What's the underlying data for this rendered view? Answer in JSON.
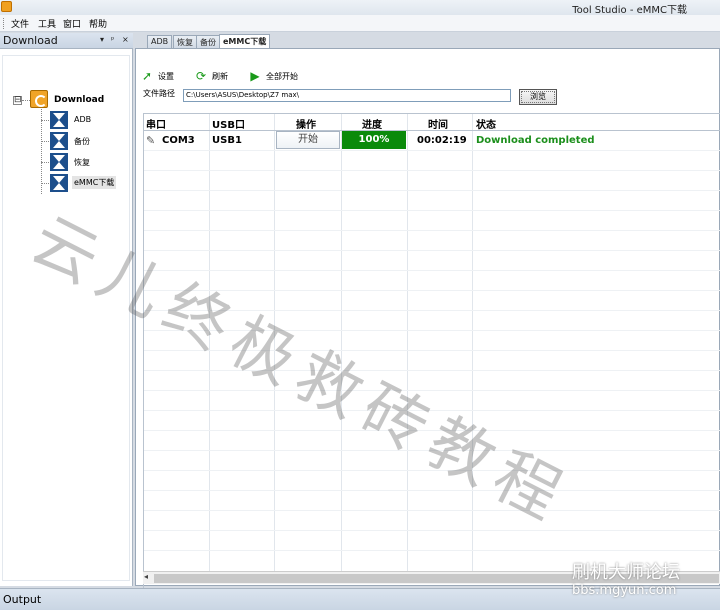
{
  "window": {
    "title": "Tool Studio - eMMC下载"
  },
  "menu": [
    "文件",
    "工具",
    "窗口",
    "帮助"
  ],
  "left_panel": {
    "title": "Download",
    "buttons": [
      "▾",
      "ᵖ",
      "×"
    ],
    "tree": {
      "root": "Download",
      "toggle": "⊟",
      "children": [
        "ADB",
        "备份",
        "恢复",
        "eMMC下载"
      ],
      "selected": "eMMC下载"
    }
  },
  "tabs": [
    "ADB",
    "恢复",
    "备份",
    "eMMC下载"
  ],
  "active_tab": "eMMC下载",
  "toolbar": [
    {
      "label": "设置",
      "icon": "arrow-right-icon"
    },
    {
      "label": "刷新",
      "icon": "refresh-icon"
    },
    {
      "label": "全部开始",
      "icon": "play-icon"
    }
  ],
  "path": {
    "label": "文件路径",
    "value": "C:\\Users\\ASUS\\Desktop\\Z7 max\\",
    "browse": "浏览"
  },
  "grid": {
    "headers": [
      "串口",
      "USB口",
      "操作",
      "进度",
      "时间",
      "状态"
    ],
    "rows": [
      {
        "port": "COM3",
        "usb": "USB1",
        "action": "开始",
        "progress_text": "100%",
        "progress": 100,
        "time": "00:02:19",
        "status": "Download completed"
      }
    ]
  },
  "colors": {
    "progress": "#0a8a0a",
    "status_ok": "#1c8f1c"
  },
  "output_panel": {
    "title": "Output"
  },
  "watermark": {
    "text": "云儿终极救砖教程",
    "site_name": "刷机大师论坛",
    "site_url": "bbs.mgyun.com"
  }
}
